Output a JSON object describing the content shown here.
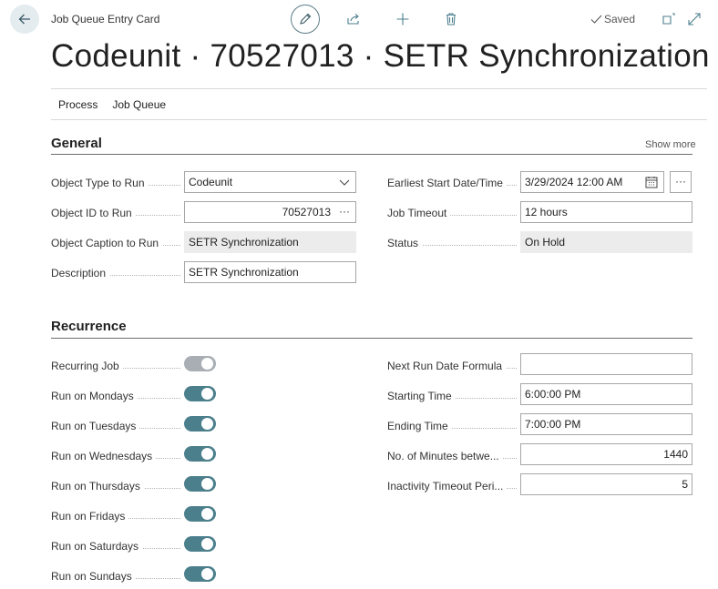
{
  "header": {
    "breadcrumb": "Job Queue Entry Card",
    "saved_label": "Saved",
    "title": "Codeunit · 70527013 · SETR Synchronization"
  },
  "actions": {
    "process": "Process",
    "job_queue": "Job Queue"
  },
  "general": {
    "title": "General",
    "show_more": "Show more",
    "object_type": {
      "label": "Object Type to Run",
      "value": "Codeunit"
    },
    "object_id": {
      "label": "Object ID to Run",
      "value": "70527013"
    },
    "object_caption": {
      "label": "Object Caption to Run",
      "value": "SETR Synchronization"
    },
    "description": {
      "label": "Description",
      "value": "SETR Synchronization"
    },
    "earliest_start": {
      "label": "Earliest Start Date/Time",
      "value": "3/29/2024 12:00 AM"
    },
    "job_timeout": {
      "label": "Job Timeout",
      "value": "12 hours"
    },
    "status": {
      "label": "Status",
      "value": "On Hold"
    }
  },
  "recurrence": {
    "title": "Recurrence",
    "toggles": [
      {
        "label": "Recurring Job",
        "on": false
      },
      {
        "label": "Run on Mondays",
        "on": true
      },
      {
        "label": "Run on Tuesdays",
        "on": true
      },
      {
        "label": "Run on Wednesdays",
        "on": true
      },
      {
        "label": "Run on Thursdays",
        "on": true
      },
      {
        "label": "Run on Fridays",
        "on": true
      },
      {
        "label": "Run on Saturdays",
        "on": true
      },
      {
        "label": "Run on Sundays",
        "on": true
      }
    ],
    "next_run_formula": {
      "label": "Next Run Date Formula",
      "value": ""
    },
    "starting_time": {
      "label": "Starting Time",
      "value": "6:00:00 PM"
    },
    "ending_time": {
      "label": "Ending Time",
      "value": "7:00:00 PM"
    },
    "minutes_between": {
      "label": "No. of Minutes betwe...",
      "value": "1440"
    },
    "inactivity_timeout": {
      "label": "Inactivity Timeout Peri...",
      "value": "5"
    }
  },
  "colors": {
    "accent": "#4c7f8c",
    "toggle_off": "#a8aeb4",
    "readonly_bg": "#ececec"
  }
}
